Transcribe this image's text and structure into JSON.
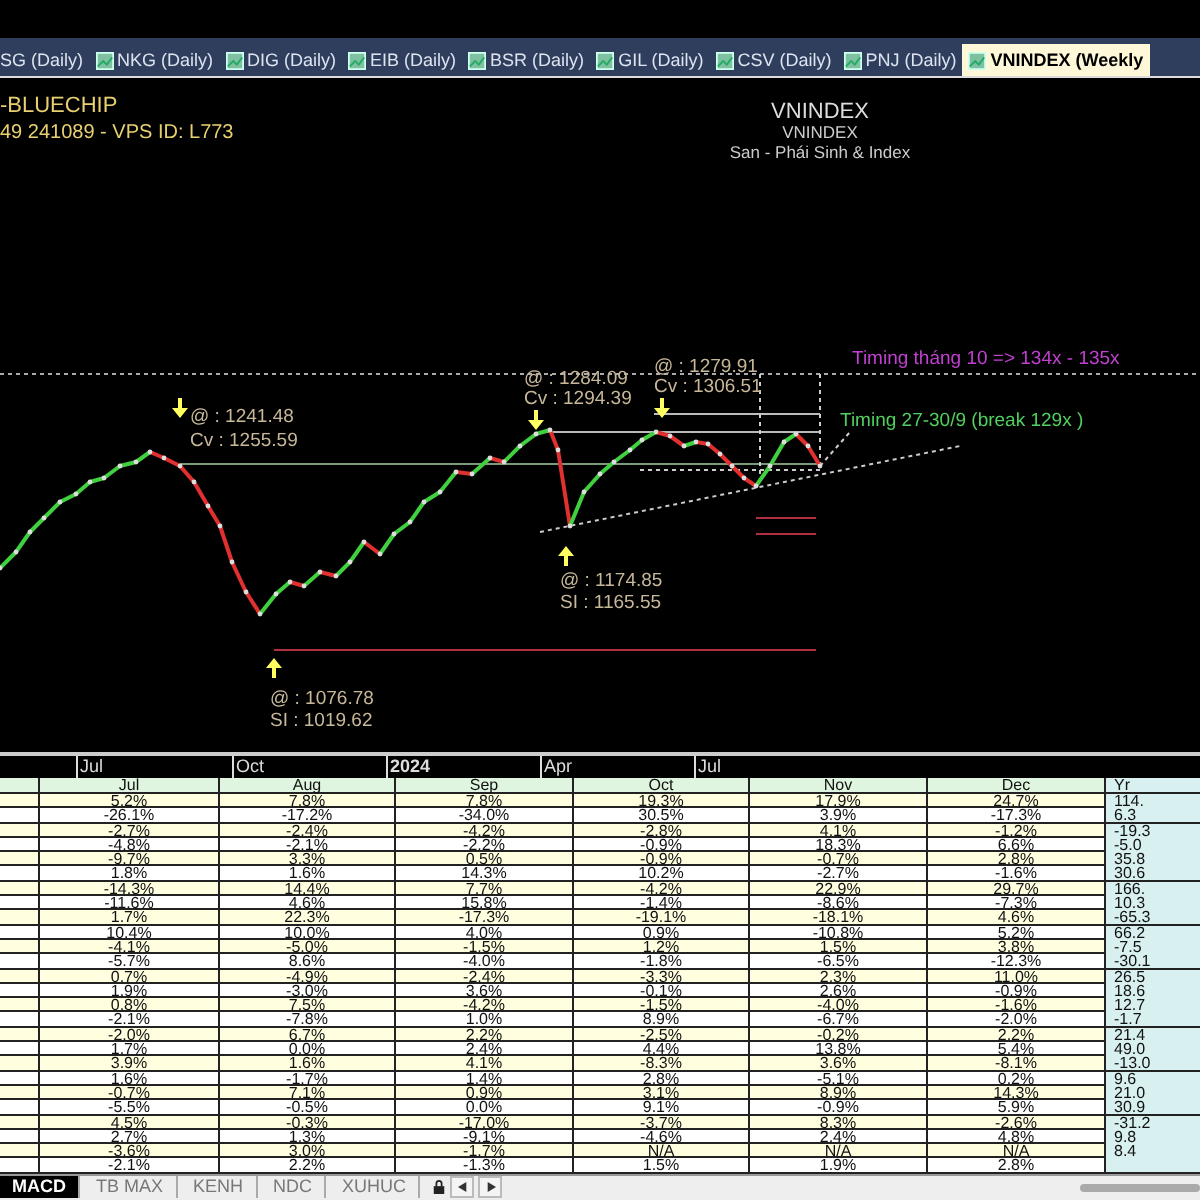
{
  "tabs": [
    {
      "label": "SG (Daily)",
      "selected": false
    },
    {
      "label": "NKG (Daily)",
      "selected": false
    },
    {
      "label": "DIG (Daily)",
      "selected": false
    },
    {
      "label": "EIB (Daily)",
      "selected": false
    },
    {
      "label": "BSR (Daily)",
      "selected": false
    },
    {
      "label": "GIL (Daily)",
      "selected": false
    },
    {
      "label": "CSV (Daily)",
      "selected": false
    },
    {
      "label": "PNJ (Daily)",
      "selected": false
    },
    {
      "label": "VNINDEX (Weekly",
      "selected": true
    }
  ],
  "chart": {
    "account_title": "-BLUECHIP",
    "account_line": "49 241089 - VPS ID: L773",
    "symbol": "VNINDEX",
    "symbol_sub": "VNINDEX",
    "exchange": "San - Phái Sinh & Index",
    "notes": [
      {
        "kind": "price",
        "text": "@ : 1241.48"
      },
      {
        "kind": "price",
        "text": "Cv : 1255.59"
      },
      {
        "kind": "price",
        "text": "@ : 1284.09"
      },
      {
        "kind": "price",
        "text": "Cv : 1294.39"
      },
      {
        "kind": "price",
        "text": "@ : 1279.91"
      },
      {
        "kind": "price",
        "text": "Cv : 1306.51"
      },
      {
        "kind": "timing-month",
        "text": "Timing tháng 10 => 134x - 135x"
      },
      {
        "kind": "timing-window",
        "text": "Timing 27-30/9 (break 129x )"
      },
      {
        "kind": "price",
        "text": "@ : 1174.85"
      },
      {
        "kind": "price",
        "text": "SI : 1165.55"
      },
      {
        "kind": "price",
        "text": "@ : 1076.78"
      },
      {
        "kind": "price",
        "text": "SI : 1019.62"
      }
    ],
    "x_labels": [
      "Jul",
      "Oct",
      "2024",
      "Apr",
      "Jul"
    ]
  },
  "table": {
    "columns": [
      "Jul",
      "Aug",
      "Sep",
      "Oct",
      "Nov",
      "Dec",
      "Yr"
    ],
    "rows": [
      [
        "5.2%",
        "7.8%",
        "7.8%",
        "19.3%",
        "17.9%",
        "24.7%",
        "114."
      ],
      [
        "-26.1%",
        "-17.2%",
        "-34.0%",
        "30.5%",
        "3.9%",
        "-17.3%",
        "6.3"
      ],
      [
        "-2.7%",
        "-2.4%",
        "-4.2%",
        "-2.8%",
        "4.1%",
        "-1.2%",
        "-19.3"
      ],
      [
        "-4.8%",
        "-2.1%",
        "-2.2%",
        "-0.9%",
        "18.3%",
        "6.6%",
        "-5.0"
      ],
      [
        "-9.7%",
        "3.3%",
        "0.5%",
        "-0.9%",
        "-0.7%",
        "2.8%",
        "35.8"
      ],
      [
        "1.8%",
        "1.6%",
        "14.3%",
        "10.2%",
        "-2.7%",
        "-1.6%",
        "30.6"
      ],
      [
        "-14.3%",
        "14.4%",
        "7.7%",
        "-4.2%",
        "22.9%",
        "29.7%",
        "166."
      ],
      [
        "-11.6%",
        "4.6%",
        "15.8%",
        "-1.4%",
        "-8.6%",
        "-7.3%",
        "10.3"
      ],
      [
        "1.7%",
        "22.3%",
        "-17.3%",
        "-19.1%",
        "-18.1%",
        "4.6%",
        "-65.3"
      ],
      [
        "10.4%",
        "10.0%",
        "4.0%",
        "0.9%",
        "-10.8%",
        "5.2%",
        "66.2"
      ],
      [
        "-4.1%",
        "-5.0%",
        "-1.5%",
        "1.2%",
        "1.5%",
        "3.8%",
        "-7.5"
      ],
      [
        "-5.7%",
        "8.6%",
        "-4.0%",
        "-1.8%",
        "-6.5%",
        "-12.3%",
        "-30.1"
      ],
      [
        "0.7%",
        "-4.9%",
        "-2.4%",
        "-3.3%",
        "2.3%",
        "11.0%",
        "26.5"
      ],
      [
        "1.9%",
        "-3.0%",
        "3.6%",
        "-0.1%",
        "2.6%",
        "-0.9%",
        "18.6"
      ],
      [
        "0.8%",
        "7.5%",
        "-4.2%",
        "-1.5%",
        "-4.0%",
        "-1.6%",
        "12.7"
      ],
      [
        "-2.1%",
        "-7.8%",
        "1.0%",
        "8.9%",
        "-6.7%",
        "-2.0%",
        "-1.7"
      ],
      [
        "-2.0%",
        "6.7%",
        "2.2%",
        "-2.5%",
        "-0.2%",
        "2.2%",
        "21.4"
      ],
      [
        "1.7%",
        "0.0%",
        "2.4%",
        "4.4%",
        "13.8%",
        "5.4%",
        "49.0"
      ],
      [
        "3.9%",
        "1.6%",
        "4.1%",
        "-8.3%",
        "3.6%",
        "-8.1%",
        "-13.0"
      ],
      [
        "1.6%",
        "-1.7%",
        "1.4%",
        "2.8%",
        "-5.1%",
        "0.2%",
        "9.6"
      ],
      [
        "-0.7%",
        "7.1%",
        "0.9%",
        "3.1%",
        "8.9%",
        "14.3%",
        "21.0"
      ],
      [
        "-5.5%",
        "-0.5%",
        "0.0%",
        "9.1%",
        "-0.9%",
        "5.9%",
        "30.9"
      ],
      [
        "4.5%",
        "-0.3%",
        "-17.0%",
        "-3.7%",
        "8.3%",
        "-2.6%",
        "-31.2"
      ],
      [
        "2.7%",
        "1.3%",
        "-9.1%",
        "-4.6%",
        "2.4%",
        "4.8%",
        "9.8"
      ],
      [
        "-3.6%",
        "3.0%",
        "-1.7%",
        "N/A",
        "N/A",
        "N/A",
        "8.4"
      ],
      [
        "-2.1%",
        "2.2%",
        "-1.3%",
        "1.5%",
        "1.9%",
        "2.8%"
      ]
    ]
  },
  "sheet_tabs": [
    {
      "label": "MACD",
      "selected": true
    },
    {
      "label": "TB MAX",
      "selected": false
    },
    {
      "label": "KENH",
      "selected": false
    },
    {
      "label": "NDC",
      "selected": false
    },
    {
      "label": "XUHUC",
      "selected": false
    }
  ]
}
